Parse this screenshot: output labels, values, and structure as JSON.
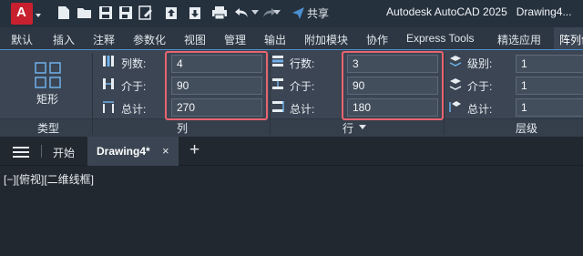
{
  "quick_access": {
    "app_letter": "A",
    "share_label": "共享",
    "title": "Autodesk AutoCAD 2025",
    "document": "Drawing4..."
  },
  "ribbon_tabs": [
    "默认",
    "插入",
    "注释",
    "参数化",
    "视图",
    "管理",
    "输出",
    "附加模块",
    "协作",
    "Express Tools",
    "精选应用",
    "阵列创"
  ],
  "active_tab_index": 11,
  "ribbon": {
    "type_panel": {
      "button_label": "矩形",
      "group_label": "类型"
    },
    "columns": {
      "group_label": "列",
      "rows": [
        {
          "label": "列数:",
          "value": "4"
        },
        {
          "label": "介于:",
          "value": "90"
        },
        {
          "label": "总计:",
          "value": "270"
        }
      ]
    },
    "rows": {
      "group_label": "行",
      "rows": [
        {
          "label": "行数:",
          "value": "3"
        },
        {
          "label": "介于:",
          "value": "90"
        },
        {
          "label": "总计:",
          "value": "180"
        }
      ]
    },
    "levels": {
      "group_label": "层级",
      "rows": [
        {
          "label": "级别:",
          "value": "1"
        },
        {
          "label": "介于:",
          "value": "1"
        },
        {
          "label": "总计:",
          "value": "1"
        }
      ]
    }
  },
  "document_tabs": {
    "start_label": "开始",
    "active_label": "Drawing4*",
    "close_glyph": "×",
    "add_glyph": "+"
  },
  "viewport": {
    "label": "[−][俯视][二维线框]"
  },
  "colors": {
    "highlight": "#e8646f",
    "app_red": "#c8202e",
    "accent_blue": "#4b8fd0"
  }
}
